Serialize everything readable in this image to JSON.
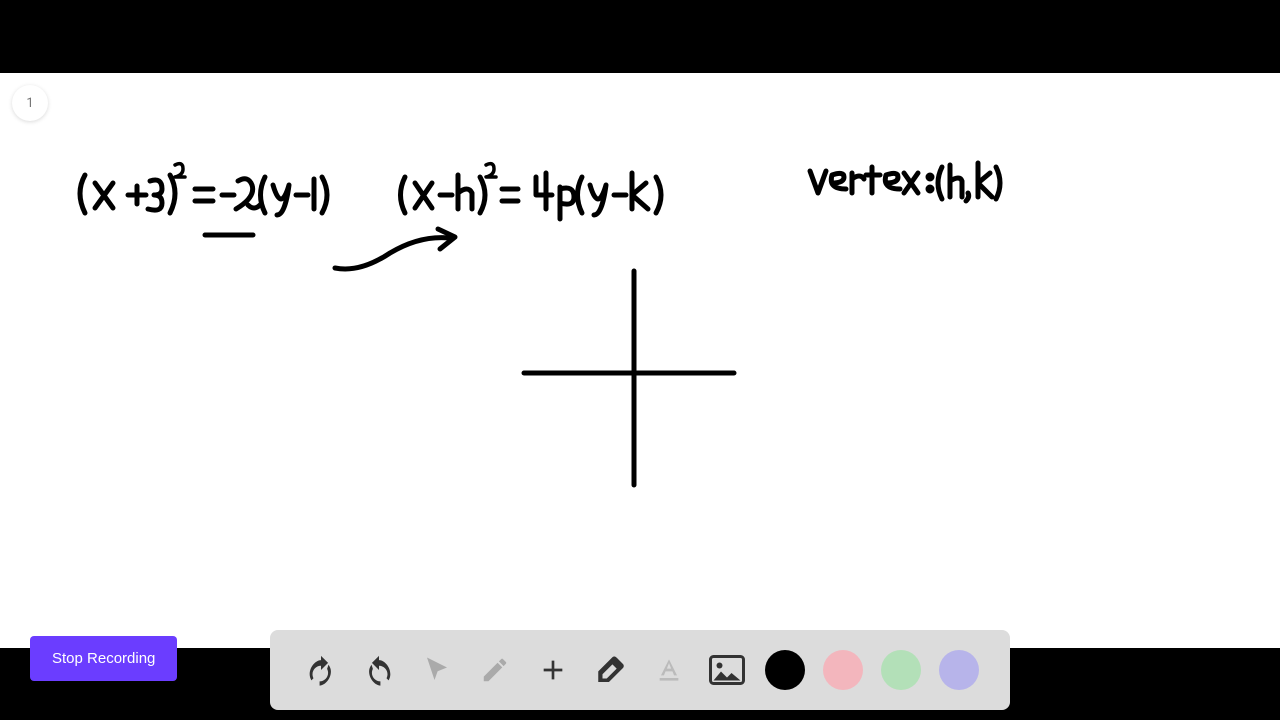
{
  "page": {
    "number": "1"
  },
  "button": {
    "stop_label": "Stop Recording"
  },
  "handwriting": {
    "eq1": "(x + 3)² = -2(y - 1)",
    "eq2": "(x - h)² = 4p(y - k)",
    "vertex_label": "vertex: (h, k)"
  },
  "toolbar": {
    "items": [
      {
        "name": "undo"
      },
      {
        "name": "redo"
      },
      {
        "name": "pointer"
      },
      {
        "name": "pencil"
      },
      {
        "name": "plus"
      },
      {
        "name": "eraser"
      },
      {
        "name": "text"
      },
      {
        "name": "image"
      }
    ],
    "colors": {
      "black": "#000000",
      "pink": "#f3b6bd",
      "green": "#b3e0b8",
      "purple": "#b7b4ea"
    }
  }
}
